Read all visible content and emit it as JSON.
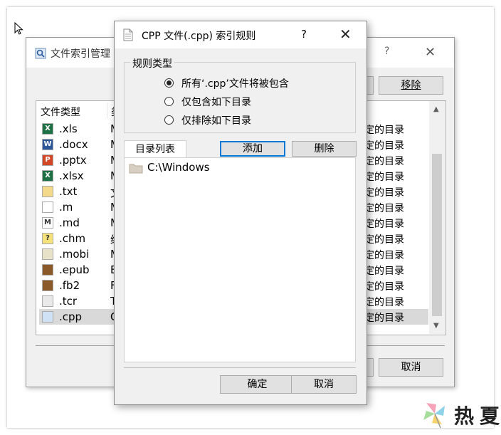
{
  "back_window": {
    "title": "文件索引管理",
    "help": "?",
    "close": "✕",
    "remove_button": "移除",
    "cancel_button": "取消",
    "columns": {
      "type": "文件类型",
      "desc": "类"
    },
    "rows": [
      {
        "ext": ".xls",
        "desc": "M",
        "scope": "定的目录",
        "icon": "excel-icon"
      },
      {
        "ext": ".docx",
        "desc": "M",
        "scope": "定的目录",
        "icon": "word-icon"
      },
      {
        "ext": ".pptx",
        "desc": "M",
        "scope": "定的目录",
        "icon": "powerpoint-icon"
      },
      {
        "ext": ".xlsx",
        "desc": "M",
        "scope": "定的目录",
        "icon": "excel-icon"
      },
      {
        "ext": ".txt",
        "desc": "文",
        "scope": "定的目录",
        "icon": "text-file-icon"
      },
      {
        "ext": ".m",
        "desc": "M",
        "scope": "定的目录",
        "icon": "document-icon"
      },
      {
        "ext": ".md",
        "desc": "M",
        "scope": "定的目录",
        "icon": "markdown-icon"
      },
      {
        "ext": ".chm",
        "desc": "编",
        "scope": "定的目录",
        "icon": "help-file-icon"
      },
      {
        "ext": ".mobi",
        "desc": "M",
        "scope": "定的目录",
        "icon": "mobi-icon"
      },
      {
        "ext": ".epub",
        "desc": "E",
        "scope": "定的目录",
        "icon": "ebook-icon"
      },
      {
        "ext": ".fb2",
        "desc": "F",
        "scope": "定的目录",
        "icon": "ebook-icon"
      },
      {
        "ext": ".tcr",
        "desc": "T",
        "scope": "定的目录",
        "icon": "blank-file-icon"
      },
      {
        "ext": ".cpp",
        "desc": "C",
        "scope": "定的目录",
        "icon": "cpp-file-icon",
        "selected": true
      }
    ]
  },
  "dialog": {
    "title": "CPP 文件(.cpp) 索引规则",
    "help": "?",
    "close": "✕",
    "group_label": "规则类型",
    "radios": [
      {
        "label": "所有‘.cpp’文件将被包含",
        "checked": true
      },
      {
        "label": "仅包含如下目录",
        "checked": false
      },
      {
        "label": "仅排除如下目录",
        "checked": false
      }
    ],
    "tab_label": "目录列表",
    "add_button": "添加",
    "delete_button": "删除",
    "directories": [
      "C:\\Windows"
    ],
    "ok_button": "确定",
    "cancel_button": "取消"
  },
  "watermark": {
    "text": "热夏"
  }
}
